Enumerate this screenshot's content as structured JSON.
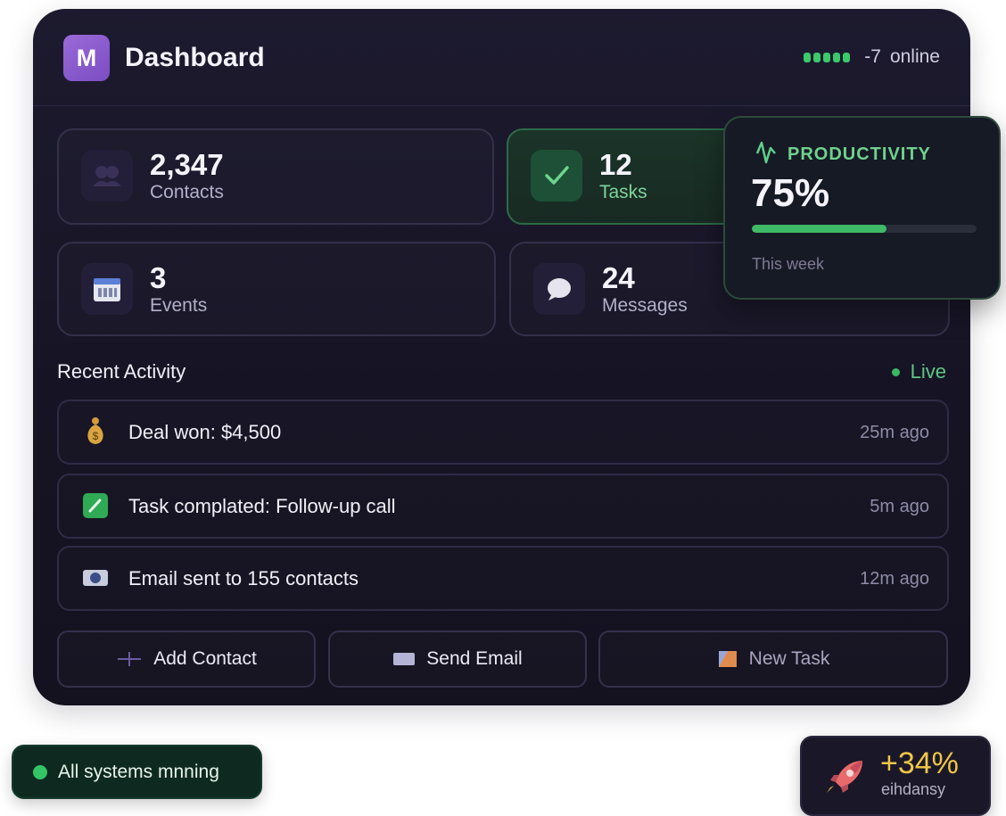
{
  "colors": {
    "accent": "#7a4dc2",
    "success": "#3bc96c",
    "highlight": "#f0c646",
    "panel_bg": "#161424"
  },
  "header": {
    "logo_letter": "M",
    "title": "Dashboard",
    "online_count": "-7",
    "online_label": "online"
  },
  "stats": [
    {
      "value": "2,347",
      "label": "Contacts",
      "icon": "contacts-icon"
    },
    {
      "value": "12",
      "label": "Tasks",
      "icon": "check-icon"
    },
    {
      "value": "3",
      "label": "Events",
      "icon": "calendar-icon"
    },
    {
      "value": "24",
      "label": "Messages",
      "icon": "chat-bubble-icon"
    }
  ],
  "productivity": {
    "title": "PRODUCTIVITY",
    "value": "75%",
    "progress_fraction": 0.6,
    "subtitle": "This week",
    "icon": "activity-icon"
  },
  "activity": {
    "title": "Recent Activity",
    "live_label": "Live",
    "items": [
      {
        "text": "Deal won: $4,500",
        "time": "25m ago",
        "icon": "money-bag-icon"
      },
      {
        "text": "Task complated: Follow-up call",
        "time": "5m ago",
        "icon": "task-check-icon"
      },
      {
        "text": "Email sent to 155 contacts",
        "time": "12m ago",
        "icon": "email-icon"
      }
    ]
  },
  "actions": [
    {
      "label": "Add Contact",
      "icon": "plus-icon"
    },
    {
      "label": "Send Email",
      "icon": "envelope-icon"
    },
    {
      "label": "New Task",
      "icon": "task-icon"
    }
  ],
  "status": {
    "label": "All systems mnning"
  },
  "growth": {
    "value": "+34%",
    "label": "eihdansy",
    "icon": "rocket-icon"
  }
}
